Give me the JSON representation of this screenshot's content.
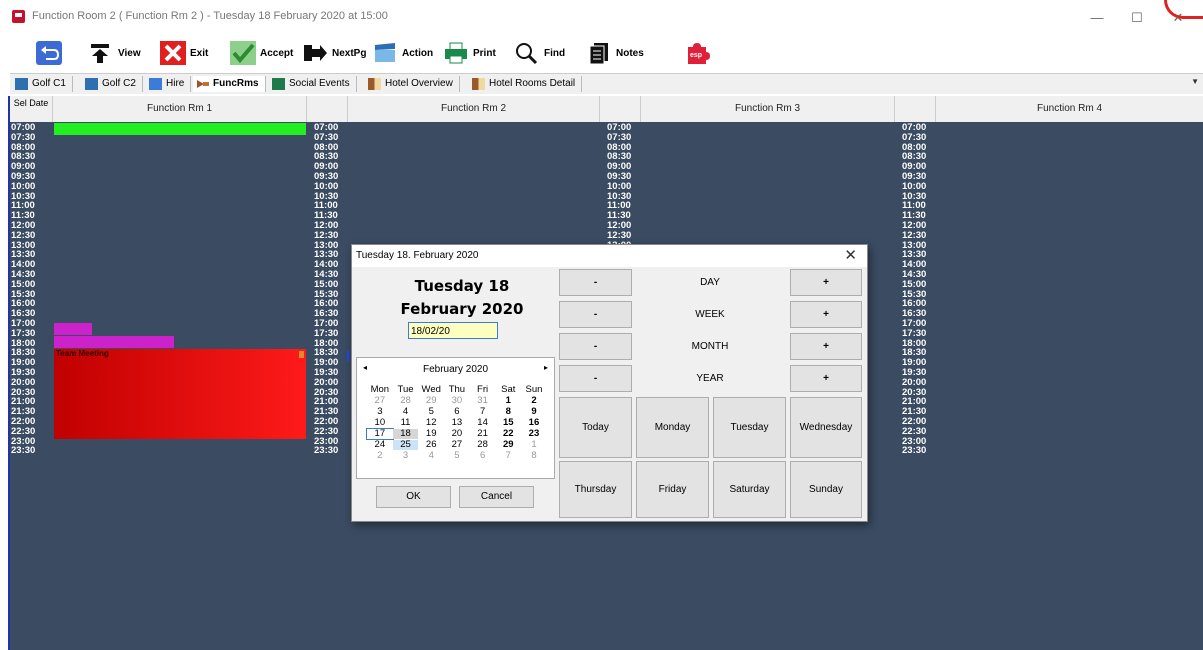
{
  "window": {
    "title": "Function Room 2 ( Function Rm 2 )  - Tuesday 18 February 2020 at 15:00"
  },
  "toolbar": [
    {
      "label": ""
    },
    {
      "label": "View"
    },
    {
      "label": "Exit"
    },
    {
      "label": "Accept"
    },
    {
      "label": "NextPg"
    },
    {
      "label": "Action"
    },
    {
      "label": "Print"
    },
    {
      "label": "Find"
    },
    {
      "label": "Notes"
    },
    {
      "label": ""
    }
  ],
  "tabs": [
    "Golf C1",
    "Golf C2",
    "Hire",
    "FuncRms",
    "Social Events",
    "Hotel Overview",
    "Hotel Rooms Detail"
  ],
  "grid": {
    "sel_date_label": "Sel Date",
    "rooms": [
      "Function Rm 1",
      "Function Rm 2",
      "Function Rm 3",
      "Function Rm 4"
    ],
    "times": [
      "07:00",
      "07:30",
      "08:00",
      "08:30",
      "09:00",
      "09:30",
      "10:00",
      "10:30",
      "11:00",
      "11:30",
      "12:00",
      "12:30",
      "13:00",
      "13:30",
      "14:00",
      "14:30",
      "15:00",
      "15:30",
      "16:00",
      "16:30",
      "17:00",
      "17:30",
      "18:00",
      "18:30",
      "19:00",
      "19:30",
      "20:00",
      "20:30",
      "21:00",
      "21:30",
      "22:00",
      "22:30",
      "23:00",
      "23:30"
    ],
    "booking_label": "Team Meeting",
    "colors": {
      "green": "#22ee22",
      "magenta": "#cc22cc",
      "red": "#dd0000",
      "background": "#3a4b62"
    }
  },
  "dialog": {
    "title": "Tuesday 18. February 2020",
    "day_line": "Tuesday 18",
    "month_line": "February 2020",
    "input_value": "18/02/20",
    "calendar": {
      "month": "February 2020",
      "prev": "◂",
      "next": "▸",
      "dow": [
        "Mon",
        "Tue",
        "Wed",
        "Thu",
        "Fri",
        "Sat",
        "Sun"
      ],
      "weeks": [
        [
          "27",
          "28",
          "29",
          "30",
          "31",
          "1",
          "2"
        ],
        [
          "3",
          "4",
          "5",
          "6",
          "7",
          "8",
          "9"
        ],
        [
          "10",
          "11",
          "12",
          "13",
          "14",
          "15",
          "16"
        ],
        [
          "17",
          "18",
          "19",
          "20",
          "21",
          "22",
          "23"
        ],
        [
          "24",
          "25",
          "26",
          "27",
          "28",
          "29",
          "1"
        ],
        [
          "2",
          "3",
          "4",
          "5",
          "6",
          "7",
          "8"
        ]
      ]
    },
    "ok": "OK",
    "cancel": "Cancel",
    "steppers": [
      {
        "minus": "-",
        "label": "DAY",
        "plus": "+"
      },
      {
        "minus": "-",
        "label": "WEEK",
        "plus": "+"
      },
      {
        "minus": "-",
        "label": "MONTH",
        "plus": "+"
      },
      {
        "minus": "-",
        "label": "YEAR",
        "plus": "+"
      }
    ],
    "quick_days": [
      "Today",
      "Monday",
      "Tuesday",
      "Wednesday",
      "Thursday",
      "Friday",
      "Saturday",
      "Sunday"
    ]
  }
}
